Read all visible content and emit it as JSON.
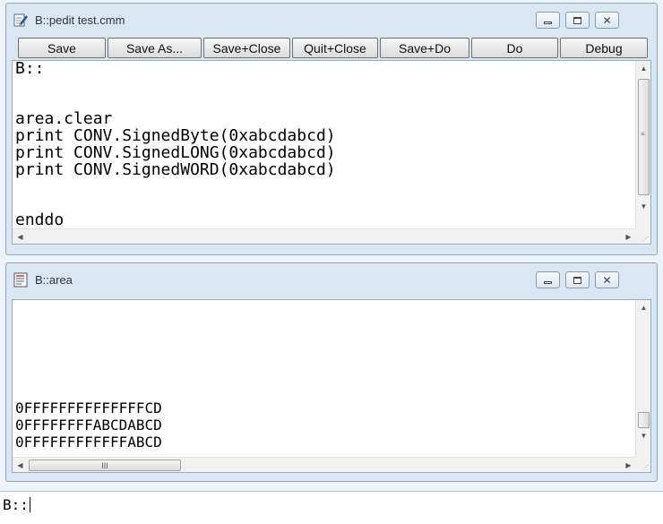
{
  "pedit_window": {
    "title": "B::pedit test.cmm",
    "toolbar": [
      {
        "label": "Save"
      },
      {
        "label": "Save As..."
      },
      {
        "label": "Save+Close"
      },
      {
        "label": "Quit+Close"
      },
      {
        "label": "Save+Do"
      },
      {
        "label": "Do"
      },
      {
        "label": "Debug"
      }
    ],
    "lines": [
      "B::",
      "",
      "area.clear",
      "print CONV.SignedByte(0xabcdabcd)",
      "print CONV.SignedLONG(0xabcdabcd)",
      "print CONV.SignedWORD(0xabcdabcd)",
      "",
      "enddo"
    ]
  },
  "area_window": {
    "title": "B::area",
    "lines": [
      "0FFFFFFFFFFFFFFCD",
      "0FFFFFFFFABCDABCD",
      "0FFFFFFFFFFFFABCD"
    ],
    "hscroll_thumb_glyph": "III"
  },
  "command_line": {
    "value": "B::"
  },
  "icons": {
    "pedit": "edit-document-icon",
    "area": "text-document-icon",
    "minimize": "minimize-icon",
    "maximize": "maximize-icon",
    "close": "close-icon"
  }
}
